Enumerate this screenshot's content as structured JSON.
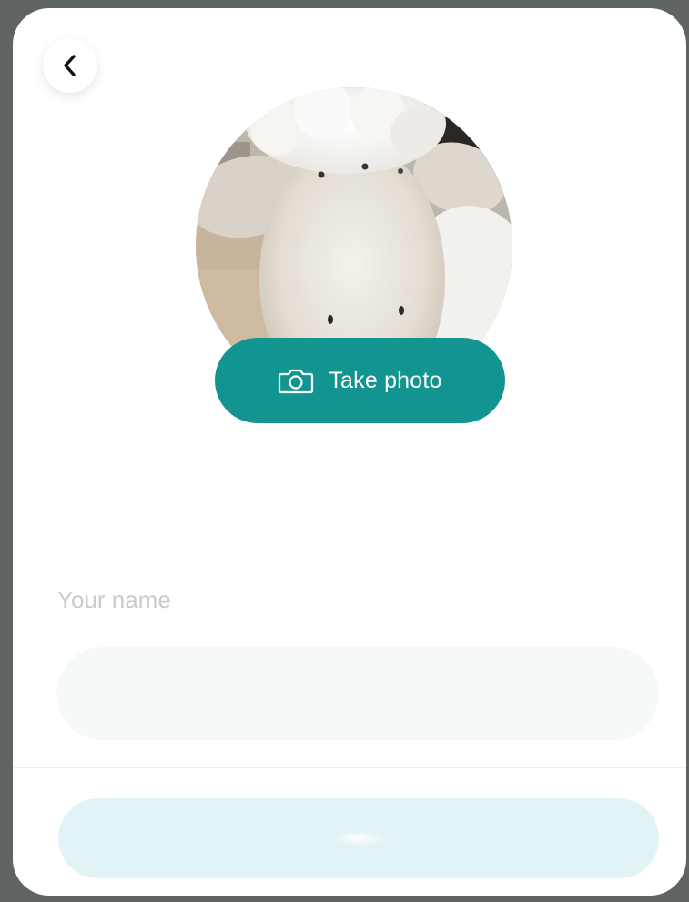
{
  "colors": {
    "accent": "#129591",
    "backdrop": "#5e6364",
    "card": "#ffffff",
    "input_bg": "#f6f9fa",
    "submit_bg": "#e2f3f5",
    "label_text": "#c7cbcd"
  },
  "header": {
    "back_icon": "chevron-left-icon"
  },
  "photo": {
    "subject": "plush sheep avatar",
    "take_photo_label": "Take photo",
    "camera_icon": "camera-icon"
  },
  "form": {
    "name_label": "Your name",
    "name_value": "",
    "name_placeholder": ""
  },
  "footer": {
    "submit_label": "",
    "submit_state": "disabled"
  }
}
